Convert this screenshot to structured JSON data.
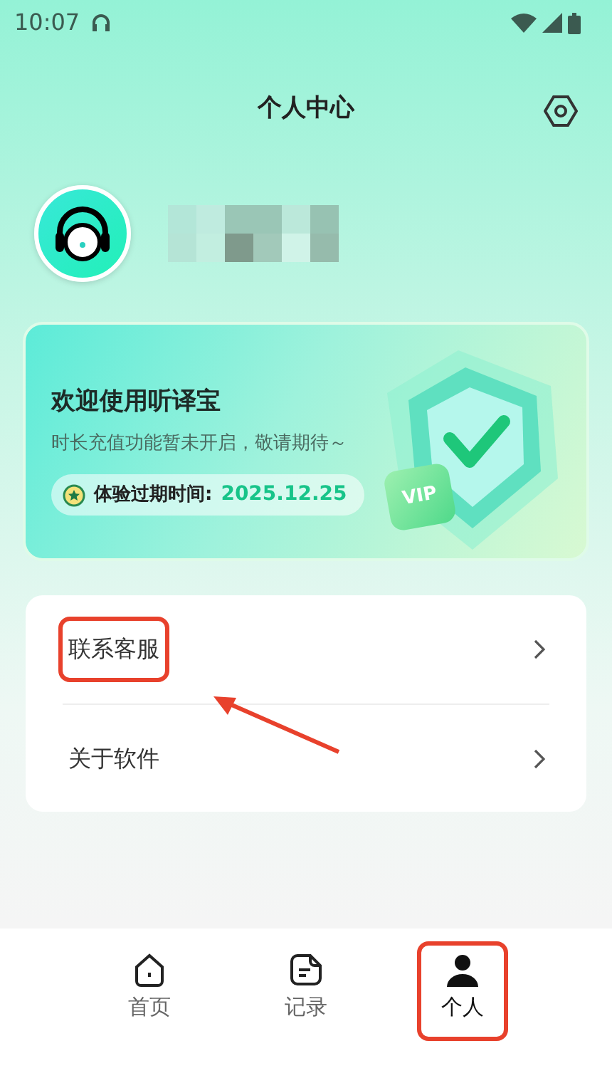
{
  "status_bar": {
    "time": "10:07"
  },
  "header": {
    "title": "个人中心"
  },
  "profile": {
    "kind": "redacted"
  },
  "vip_card": {
    "title": "欢迎使用听译宝",
    "subtitle": "时长充值功能暂未开启，敬请期待～",
    "expiry_label": "体验过期时间:",
    "expiry_date": "2025.12.25",
    "badge": "VIP"
  },
  "menu": [
    {
      "label": "联系客服",
      "highlighted": true
    },
    {
      "label": "关于软件",
      "highlighted": false
    }
  ],
  "tabs": [
    {
      "label": "首页",
      "kind": "home",
      "selected": false,
      "highlighted": false
    },
    {
      "label": "记录",
      "kind": "note",
      "selected": false,
      "highlighted": false
    },
    {
      "label": "个人",
      "kind": "person",
      "selected": true,
      "highlighted": true
    }
  ]
}
